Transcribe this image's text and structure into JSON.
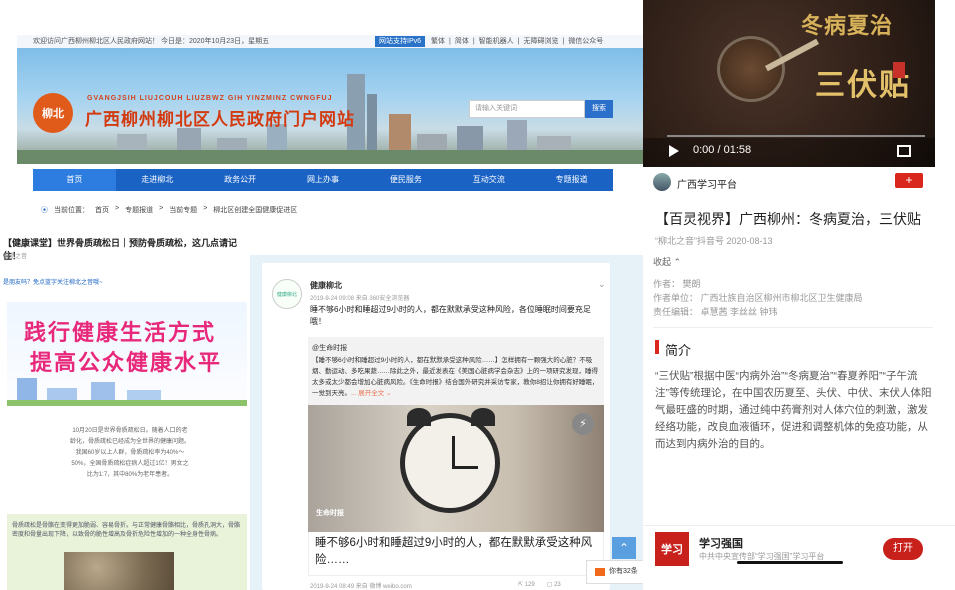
{
  "gov": {
    "welcome": "欢迎访问广西柳州柳北区人民政府网站！ 今日是：2020年10月23日，星期五",
    "ipv6": "网站支持IPv6",
    "toplinks": [
      "繁体",
      "简体",
      "智能机器人",
      "无障碍浏览",
      "微信公众号"
    ],
    "logo_text": "柳北",
    "pinyin": "GVANGJSIH LIUJCOUH LIUZBWZ GIH YINZMINZ CWNGFUJ",
    "site_name": "广西柳州柳北区人民政府门户网站",
    "search_placeholder": "请输入关键词",
    "search_button": "搜索",
    "nav": [
      "首页",
      "走进柳北",
      "政务公开",
      "网上办事",
      "便民服务",
      "互动交流",
      "专题报道"
    ],
    "breadcrumb": [
      "当前位置：",
      "首页",
      "专题报道",
      "当前专题",
      "柳北区创建全国健康促进区"
    ]
  },
  "health": {
    "title": "【健康课堂】世界骨质疏松日｜预防骨质疏松，这几点请记住！",
    "source": "柳北之音",
    "follow": "是朋友吗？免点蓝字关注柳北之音哦~",
    "poster_line1": "践行健康生活方式",
    "poster_line2": "提高公众健康水平",
    "body": "10月20日是世界骨质疏松日。随着人口的老龄化，骨质疏松已经成为全世界的健康问题。我国60岁以上人群，骨质疏松率为40%～50%，全国骨质疏松症病人超过1亿！男女之比为1:7，其中80%为老年患者。",
    "green_text": "骨质疏松是骨骼在变得更加脆弱、容易骨折。与正常健康骨骼相比，骨质孔洞大，骨骼密度和骨量出现下降，以致骨的脆性增高及骨折危险性增加的一种全身性骨病。"
  },
  "weibo": {
    "avatar_label": "健康柳北",
    "user": "健康柳北",
    "meta": "2019-9-24 09:08 来自 360安全浏览器",
    "text": "睡不够6小时和睡超过9小时的人，都在默默承受这种风险，各位睡眠时间要充足哦！",
    "repost_user": "@生命时报",
    "repost_text": "【睡不够6小时和睡超过9小时的人，都在默默承受这种风险……】怎样拥有一颗强大的心脏？不吸烟、勤运动、多吃果蔬……除此之外，最近发表在《美国心脏病学会杂志》上的一项研究发现，睡得太多或太少都会增加心脏病风险。《生命时报》结合国外研究并采访专家，教你8招让你拥有好睡眠，一觉到天亮。",
    "more": "... 展开全文 ⌄",
    "image_label": "生命时报",
    "caption": "睡不够6小时和睡超过9小时的人，都在默默承受这种风险……",
    "foot": "2019-9-24 08:49 来自 微博 weibo.com",
    "reposts": "129",
    "comments": "23",
    "toast": "你有32条"
  },
  "right": {
    "video_title1": "冬病夏治",
    "video_title2": "三伏贴",
    "time": "0:00 / 01:58",
    "channel": "广西学习平台",
    "follow_btn": "+",
    "article_title": "【百灵视界】广西柳州：冬病夏治，三伏贴",
    "article_src": "“柳北之音”抖音号  2020-08-13",
    "collapse": "收起 ⌃",
    "author": "作者： 樊朗",
    "unit": "作者单位： 广西壮族自治区柳州市柳北区卫生健康局",
    "editor": "责任编辑： 卓慧茜  李丝丝  钟玮",
    "section": "简介",
    "para": "“三伏贴”根据中医“内病外治”“冬病夏治”“春夏养阳”“子午流注”等传统理论，在中国农历夏至、头伏、中伏、末伏人体阳气最旺盛的时期，通过纯中药膏剂对人体穴位的刺激，激发经络功能，改良血液循环，促进和调整机体的免疫功能，从而达到内病外治的目的。",
    "app_logo": "学习",
    "app_name": "学习强国",
    "app_sub": "中共中央宣传部“学习强国”学习平台",
    "open": "打开"
  }
}
